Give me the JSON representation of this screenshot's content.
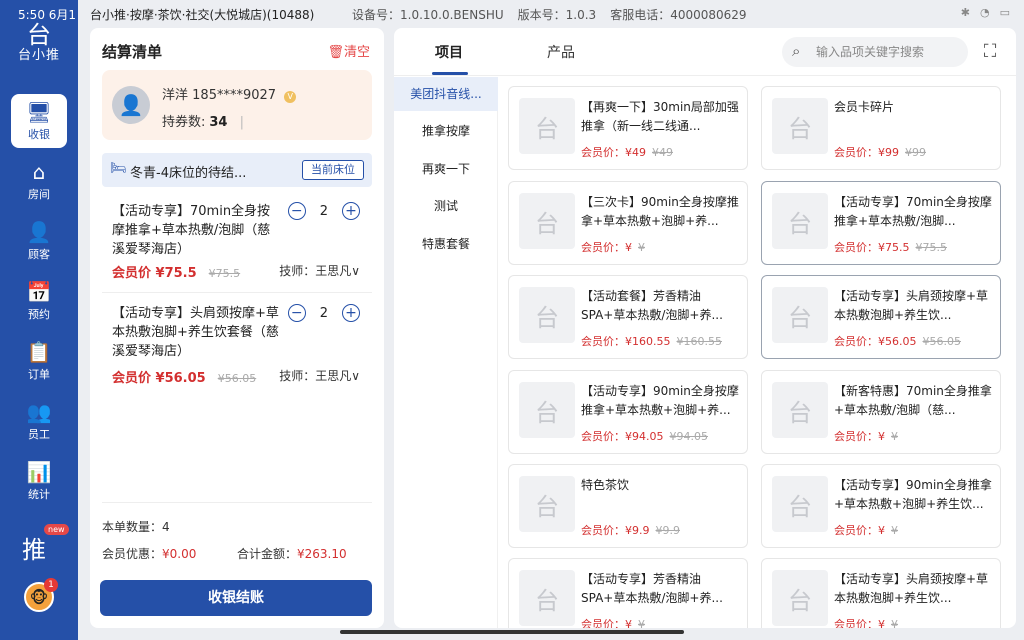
{
  "status_bar": {
    "time": "5:50",
    "date": "6月1",
    "store": "台小推·按摩·茶饮·社交(大悦城店)(10488)",
    "device": "设备号：1.0.10.0.BENSHU",
    "version": "版本号：1.0.3",
    "service": "客服电话：4000080629"
  },
  "sidebar": {
    "logo_glyph": "台",
    "logo_text": "台小推",
    "items": [
      {
        "label": "收银",
        "icon": "🖥"
      },
      {
        "label": "房间",
        "icon": "⌂"
      },
      {
        "label": "顾客",
        "icon": "👤"
      },
      {
        "label": "预约",
        "icon": "📅"
      },
      {
        "label": "订单",
        "icon": "📋"
      },
      {
        "label": "员工",
        "icon": "👥"
      },
      {
        "label": "统计",
        "icon": "📊"
      }
    ],
    "new_badge": "new",
    "new_icon": "推",
    "avatar_icon": "🐵",
    "notification_count": "1"
  },
  "checkout": {
    "title": "结算清单",
    "clear": "清空",
    "member": {
      "name": "洋洋",
      "phone": "185****9027",
      "coupon_label": "持券数:",
      "coupon_count": "34"
    },
    "bed": {
      "text": "冬青-4床位的待结...",
      "button": "当前床位"
    },
    "items": [
      {
        "name": "【活动专享】70min全身按摩推拿+草本热敷/泡脚（慈溪爱琴海店）",
        "qty": "2",
        "member_price": "会员价 ¥75.5",
        "orig_price": "¥75.5",
        "tech": "技师：王思凡"
      },
      {
        "name": "【活动专享】头肩颈按摩+草本热敷泡脚+养生饮套餐（慈溪爱琴海店）",
        "qty": "2",
        "member_price": "会员价 ¥56.05",
        "orig_price": "¥56.05",
        "tech": "技师：王思凡"
      }
    ],
    "summary": {
      "count_label": "本单数量：",
      "count": "4",
      "discount_label": "会员优惠：",
      "discount": "¥0.00",
      "total_label": "合计金额：",
      "total": "¥263.10"
    },
    "submit": "收银结账"
  },
  "products_panel": {
    "tabs": [
      "项目",
      "产品"
    ],
    "search_placeholder": "输入品项关键字搜索",
    "categories": [
      "美团抖音线...",
      "推拿按摩",
      "再爽一下",
      "测试",
      "特惠套餐"
    ],
    "products": [
      {
        "name": "【再爽一下】30min局部加强推拿（新一线二线通...",
        "price": "会员价：¥49",
        "orig": "¥49"
      },
      {
        "name": "会员卡碎片",
        "price": "会员价：¥99",
        "orig": "¥99"
      },
      {
        "name": "【三次卡】90min全身按摩推拿+草本热敷+泡脚+养...",
        "price": "会员价：¥",
        "orig": "¥"
      },
      {
        "name": "【活动专享】70min全身按摩推拿+草本热敷/泡脚...",
        "price": "会员价：¥75.5",
        "orig": "¥75.5"
      },
      {
        "name": "【活动套餐】芳香精油SPA+草本热敷/泡脚+养...",
        "price": "会员价：¥160.55",
        "orig": "¥160.55"
      },
      {
        "name": "【活动专享】头肩颈按摩+草本热敷泡脚+养生饮...",
        "price": "会员价：¥56.05",
        "orig": "¥56.05"
      },
      {
        "name": "【活动专享】90min全身按摩推拿+草本热敷+泡脚+养...",
        "price": "会员价：¥94.05",
        "orig": "¥94.05"
      },
      {
        "name": "【新客特惠】70min全身推拿+草本热敷/泡脚（慈...",
        "price": "会员价：¥",
        "orig": "¥"
      },
      {
        "name": "特色茶饮",
        "price": "会员价：¥9.9",
        "orig": "¥9.9"
      },
      {
        "name": "【活动专享】90min全身推拿+草本热敷+泡脚+养生饮...",
        "price": "会员价：¥",
        "orig": "¥"
      },
      {
        "name": "【活动专享】芳香精油SPA+草本热敷/泡脚+养...",
        "price": "会员价：¥",
        "orig": "¥"
      },
      {
        "name": "【活动专享】头肩颈按摩+草本热敷泡脚+养生饮...",
        "price": "会员价：¥",
        "orig": "¥"
      }
    ]
  }
}
